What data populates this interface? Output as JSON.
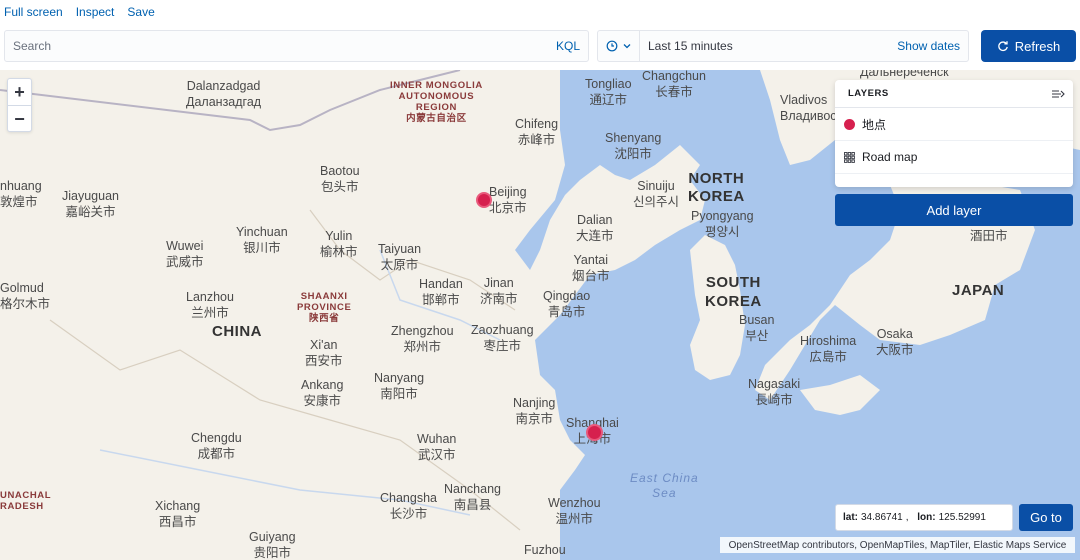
{
  "toolbar": {
    "full_screen": "Full screen",
    "inspect": "Inspect",
    "save": "Save"
  },
  "search": {
    "placeholder": "Search",
    "kql": "KQL"
  },
  "date": {
    "range": "Last 15 minutes",
    "show_dates": "Show dates"
  },
  "refresh_label": "Refresh",
  "zoom": {
    "in": "+",
    "out": "−"
  },
  "layers": {
    "title": "LAYERS",
    "items": [
      {
        "label": "地点"
      },
      {
        "label": "Road map"
      }
    ],
    "add_label": "Add layer"
  },
  "coords": {
    "lat_label": "lat:",
    "lat": "34.86741",
    "lon_label": "lon:",
    "lon": "125.52991",
    "goto_label": "Go to"
  },
  "attribution": "OpenStreetMap contributors, OpenMapTiles, MapTiler, Elastic Maps Service",
  "map_labels": {
    "dalanzadgad": "Dalanzadgad",
    "dalanzadgad_c": "Даланзадгад",
    "inner_mongolia": "INNER MONGOLIA",
    "autonomous": "AUTONOMOUS",
    "region": "REGION",
    "inner_mongolia_c": "内蒙古自治区",
    "tongliao": "Tongliao",
    "tongliao_c": "通辽市",
    "changchun": "Changchun",
    "changchun_c": "长春市",
    "dalnerechensk": "Дальнереченск",
    "vladivostok": "Vladivos",
    "vladivostok_c": "Владивос",
    "chifeng": "Chifeng",
    "chifeng_c": "赤峰市",
    "shenyang": "Shenyang",
    "shenyang_c": "沈阳市",
    "nhuang": "nhuang",
    "nhuang_c": "敦煌市",
    "jiayuguan": "Jiayuguan",
    "jiayuguan_c": "嘉峪关市",
    "baotou": "Baotou",
    "baotou_c": "包头市",
    "beijing": "Beijing",
    "beijing_c": "北京市",
    "sinuiju": "Sinuiju",
    "sinuiju_c": "신의주시",
    "north": "NORTH",
    "korea": "KOREA",
    "pyongyang": "Pyongyang",
    "pyongyang_c": "평양시",
    "yinchuan": "Yinchuan",
    "yinchuan_c": "银川市",
    "yulin": "Yulin",
    "yulin_c": "榆林市",
    "dalian": "Dalian",
    "dalian_c": "大连市",
    "sakata_c": "酒田市",
    "wuwei": "Wuwei",
    "wuwei_c": "武威市",
    "taiyuan": "Taiyuan",
    "taiyuan_c": "太原市",
    "yantai": "Yantai",
    "yantai_c": "烟台市",
    "golmud": "Golmud",
    "golmud_c": "格尔木市",
    "handan": "Handan",
    "handan_c": "邯郸市",
    "jinan": "Jinan",
    "jinan_c": "济南市",
    "south": "SOUTH",
    "korea2": "KOREA",
    "japan": "JAPAN",
    "lanzhou": "Lanzhou",
    "lanzhou_c": "兰州市",
    "shaanxi": "SHAANXI",
    "province": "PROVINCE",
    "shaanxi_c": "陕西省",
    "qingdao": "Qingdao",
    "qingdao_c": "青岛市",
    "china": "CHINA",
    "zhengzhou": "Zhengzhou",
    "zhengzhou_c": "郑州市",
    "zaozhuang": "Zaozhuang",
    "zaozhuang_c": "枣庄市",
    "busan": "Busan",
    "busan_c": "부산",
    "hiroshima": "Hiroshima",
    "hiroshima_c": "広島市",
    "osaka": "Osaka",
    "osaka_c": "大阪市",
    "xian": "Xi'an",
    "xian_c": "西安市",
    "nanyang": "Nanyang",
    "nanyang_c": "南阳市",
    "ankang": "Ankang",
    "ankang_c": "安康市",
    "nagasaki": "Nagasaki",
    "nagasaki_c": "長崎市",
    "nanjing": "Nanjing",
    "nanjing_c": "南京市",
    "chengdu": "Chengdu",
    "chengdu_c": "成都市",
    "wuhan": "Wuhan",
    "wuhan_c": "武汉市",
    "shanghai": "Shanghai",
    "shanghai_c": "上海市",
    "east_china": "East China",
    "sea": "Sea",
    "unachal": "UNACHAL",
    "adesh": "RADESH",
    "changsha": "Changsha",
    "changsha_c": "长沙市",
    "nanchang": "Nanchang",
    "nanchang_c": "南昌县",
    "wenzhou": "Wenzhou",
    "wenzhou_c": "温州市",
    "xichang": "Xichang",
    "xichang_c": "西昌市",
    "guiyang": "Guiyang",
    "guiyang_c": "贵阳市",
    "fuzhou": "Fuzhou"
  },
  "colors": {
    "accent": "#0a4fa6",
    "link": "#0061b0",
    "point": "#d6204e",
    "sea": "#a9c6ec",
    "land": "#f4f1ea"
  }
}
